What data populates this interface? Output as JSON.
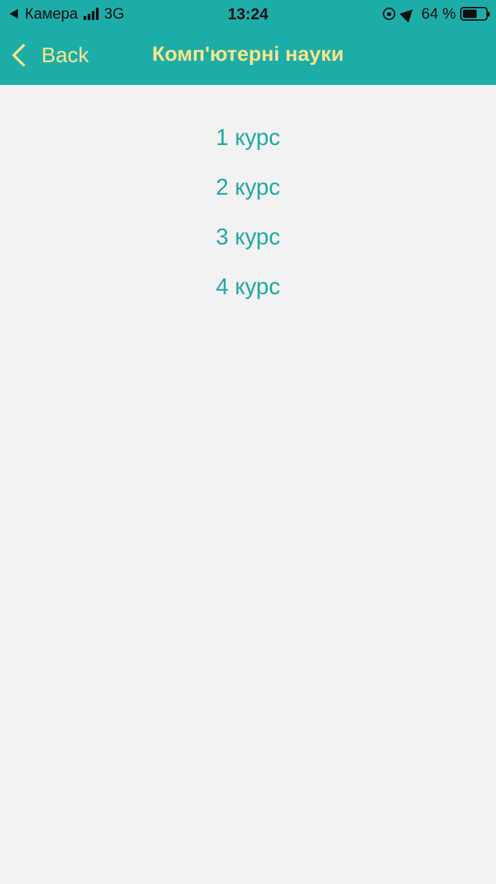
{
  "status_bar": {
    "back_app": "Камера",
    "network": "3G",
    "time": "13:24",
    "battery_percent": "64 %",
    "battery_level": 0.64,
    "icons": [
      "back-triangle-icon",
      "signal-icon",
      "orientation-lock-icon",
      "location-icon",
      "battery-icon"
    ]
  },
  "nav": {
    "back_label": "Back",
    "title": "Комп'ютерні науки",
    "colors": {
      "bar_background": "#1dada8",
      "title": "#fbe58a"
    }
  },
  "courses": [
    {
      "label": "1 курс"
    },
    {
      "label": "2 курс"
    },
    {
      "label": "3 курс"
    },
    {
      "label": "4 курс"
    }
  ],
  "colors": {
    "page_background": "#f2f2f2",
    "course_text": "#1ea9a4"
  }
}
